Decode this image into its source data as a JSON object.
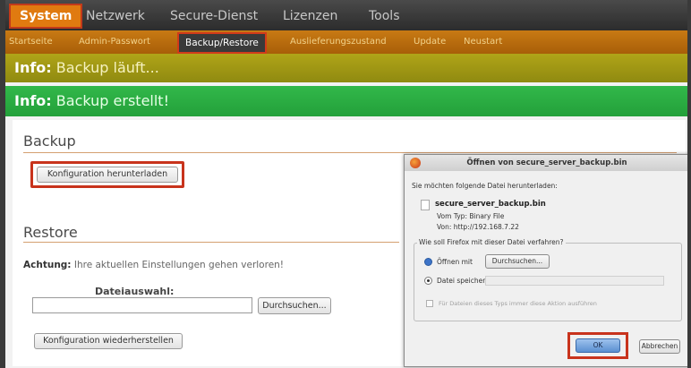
{
  "topnav": {
    "items": [
      "System",
      "Netzwerk",
      "Secure-Dienst",
      "Lizenzen",
      "Tools"
    ]
  },
  "subnav": {
    "items": [
      "Startseite",
      "Admin-Passwort",
      "Backup/Restore",
      "Auslieferungszustand",
      "Update",
      "Neustart"
    ]
  },
  "info": {
    "label": "Info:",
    "backup_running": "Backup läuft...",
    "backup_created": "Backup erstellt!"
  },
  "backup": {
    "heading": "Backup",
    "download_button": "Konfiguration herunterladen"
  },
  "restore": {
    "heading": "Restore",
    "warning_label": "Achtung:",
    "warning_text": "Ihre aktuellen Einstellungen gehen verloren!",
    "file_label": "Dateiauswahl:",
    "browse_button": "Durchsuchen...",
    "restore_button": "Konfiguration wiederherstellen"
  },
  "dialog": {
    "title": "Öffnen von secure_server_backup.bin",
    "intro": "Sie möchten folgende Datei herunterladen:",
    "filename": "secure_server_backup.bin",
    "type_line": "Vom Typ: Binary File",
    "from_line": "Von: http://192.168.7.22",
    "question": "Wie soll Firefox mit dieser Datei verfahren?",
    "open_with_label": "Öffnen mit",
    "open_with_browse": "Durchsuchen...",
    "save_label": "Datei speichern",
    "auto_checkbox_label": "Für Dateien dieses Typs immer diese Aktion ausführen",
    "ok_button": "OK",
    "cancel_button": "Abbrechen"
  },
  "colors": {
    "nav_active": "#e07a10",
    "highlight_frame": "#c8331c",
    "info_running": "#b0a418",
    "info_created": "#32b84a"
  }
}
